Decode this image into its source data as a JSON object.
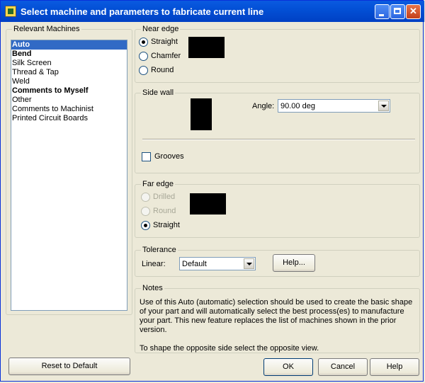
{
  "window": {
    "title": "Select machine and parameters to fabricate current line"
  },
  "machines": {
    "label": "Relevant Machines",
    "items": [
      {
        "label": "Auto",
        "bold": true,
        "selected": true
      },
      {
        "label": "Bend",
        "bold": true,
        "selected": false
      },
      {
        "label": "Silk Screen",
        "bold": false,
        "selected": false
      },
      {
        "label": "Thread & Tap",
        "bold": false,
        "selected": false
      },
      {
        "label": "Weld",
        "bold": false,
        "selected": false
      },
      {
        "label": "Comments to Myself",
        "bold": true,
        "selected": false
      },
      {
        "label": "Other",
        "bold": false,
        "selected": false
      },
      {
        "label": "Comments to Machinist",
        "bold": false,
        "selected": false
      },
      {
        "label": "Printed Circuit Boards",
        "bold": false,
        "selected": false
      }
    ]
  },
  "near_edge": {
    "label": "Near edge",
    "options": [
      "Straight",
      "Chamfer",
      "Round"
    ],
    "selected": "Straight"
  },
  "side_wall": {
    "label": "Side wall",
    "angle_label": "Angle:",
    "angle_value": "90.00 deg",
    "grooves_label": "Grooves",
    "grooves_checked": false
  },
  "far_edge": {
    "label": "Far edge",
    "options": [
      "Drilled",
      "Round",
      "Straight"
    ],
    "disabled": [
      "Drilled",
      "Round"
    ],
    "selected": "Straight"
  },
  "tolerance": {
    "label": "Tolerance",
    "linear_label": "Linear:",
    "linear_value": "Default",
    "help_label": "Help..."
  },
  "notes": {
    "label": "Notes",
    "text": "Use of this Auto (automatic) selection should be used to create the basic shape of your part and will automatically select the best process(es) to manufacture your part. This new feature replaces the list of machines shown in the prior version.",
    "text2": "To shape the opposite side select the opposite view."
  },
  "buttons": {
    "reset": "Reset to Default",
    "ok": "OK",
    "cancel": "Cancel",
    "help": "Help"
  }
}
